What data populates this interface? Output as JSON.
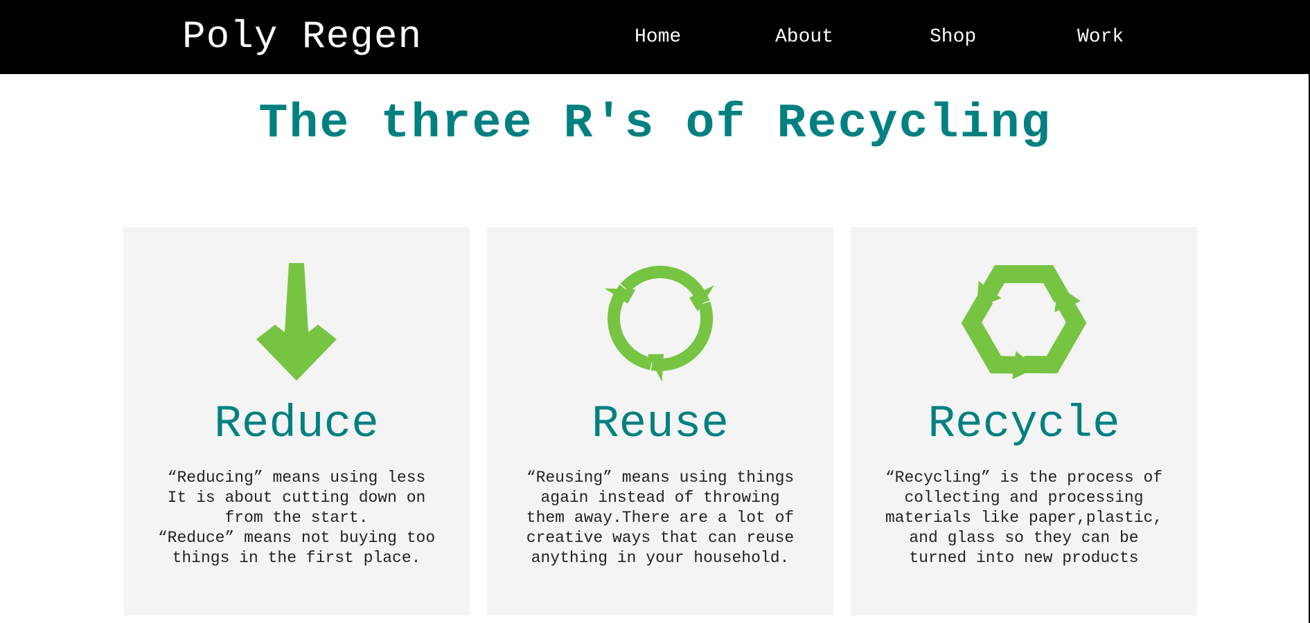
{
  "header": {
    "brand": "Poly Regen",
    "nav": [
      {
        "label": "Home"
      },
      {
        "label": "About"
      },
      {
        "label": "Shop"
      },
      {
        "label": "Work"
      }
    ]
  },
  "main": {
    "headline": "The three R's of Recycling",
    "cards": [
      {
        "icon": "down-arrow-icon",
        "title": "Reduce",
        "text": "“Reducing” means using less\nIt is about cutting down on\nfrom the start.\n“Reduce” means not buying too\nthings in the first place."
      },
      {
        "icon": "circular-arrows-icon",
        "title": "Reuse",
        "text": "“Reusing” means using things\nagain instead of throwing\nthem away.There are a lot of\ncreative ways that can reuse\nanything in your household."
      },
      {
        "icon": "recycle-icon",
        "title": "Recycle",
        "text": "“Recycling” is the process of\ncollecting and processing\nmaterials like paper,plastic,\nand glass so they can be\nturned into new products"
      }
    ]
  },
  "colors": {
    "navbar": "#000000",
    "accent": "#008080",
    "icon_green": "#76c442",
    "card_bg": "#f4f4f4"
  }
}
